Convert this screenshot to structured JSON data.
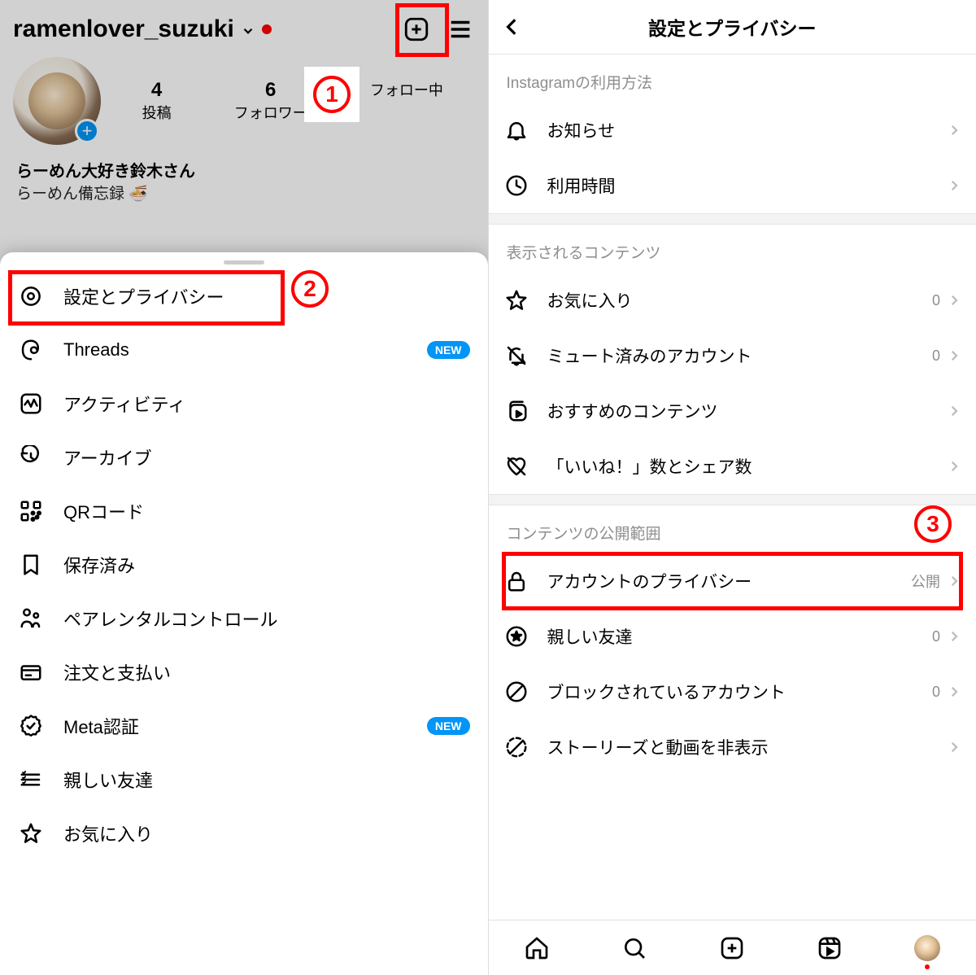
{
  "left": {
    "username": "ramenlover_suzuki",
    "stats": [
      {
        "num": "4",
        "label": "投稿"
      },
      {
        "num": "6",
        "label": "フォロワー"
      },
      {
        "num": "",
        "label": "フォロー中"
      }
    ],
    "bio_name": "らーめん大好き鈴木さん",
    "bio_desc": "らーめん備忘録 🍜",
    "menu": [
      {
        "label": "設定とプライバシー",
        "icon": "gear"
      },
      {
        "label": "Threads",
        "icon": "threads",
        "badge": "NEW"
      },
      {
        "label": "アクティビティ",
        "icon": "activity"
      },
      {
        "label": "アーカイブ",
        "icon": "archive"
      },
      {
        "label": "QRコード",
        "icon": "qr"
      },
      {
        "label": "保存済み",
        "icon": "bookmark"
      },
      {
        "label": "ペアレンタルコントロール",
        "icon": "parental"
      },
      {
        "label": "注文と支払い",
        "icon": "card"
      },
      {
        "label": "Meta認証",
        "icon": "verified",
        "badge": "NEW"
      },
      {
        "label": "親しい友達",
        "icon": "closefriends"
      },
      {
        "label": "お気に入り",
        "icon": "star"
      }
    ],
    "step_labels": {
      "1": "1",
      "2": "2"
    }
  },
  "right": {
    "title": "設定とプライバシー",
    "sec1_title": "Instagramの利用方法",
    "sec1": [
      {
        "label": "お知らせ",
        "icon": "bell"
      },
      {
        "label": "利用時間",
        "icon": "clock"
      }
    ],
    "sec2_title": "表示されるコンテンツ",
    "sec2": [
      {
        "label": "お気に入り",
        "icon": "star",
        "trail": "0"
      },
      {
        "label": "ミュート済みのアカウント",
        "icon": "bellslash",
        "trail": "0"
      },
      {
        "label": "おすすめのコンテンツ",
        "icon": "reelsplay"
      },
      {
        "label": "「いいね！」数とシェア数",
        "icon": "heartslash"
      }
    ],
    "sec3_title": "コンテンツの公開範囲",
    "sec3": [
      {
        "label": "アカウントのプライバシー",
        "icon": "lock",
        "trail": "公開"
      },
      {
        "label": "親しい友達",
        "icon": "starcircle",
        "trail": "0"
      },
      {
        "label": "ブロックされているアカウント",
        "icon": "block",
        "trail": "0"
      },
      {
        "label": "ストーリーズと動画を非表示",
        "icon": "dashedcircle"
      }
    ],
    "step_labels": {
      "3": "3"
    }
  }
}
